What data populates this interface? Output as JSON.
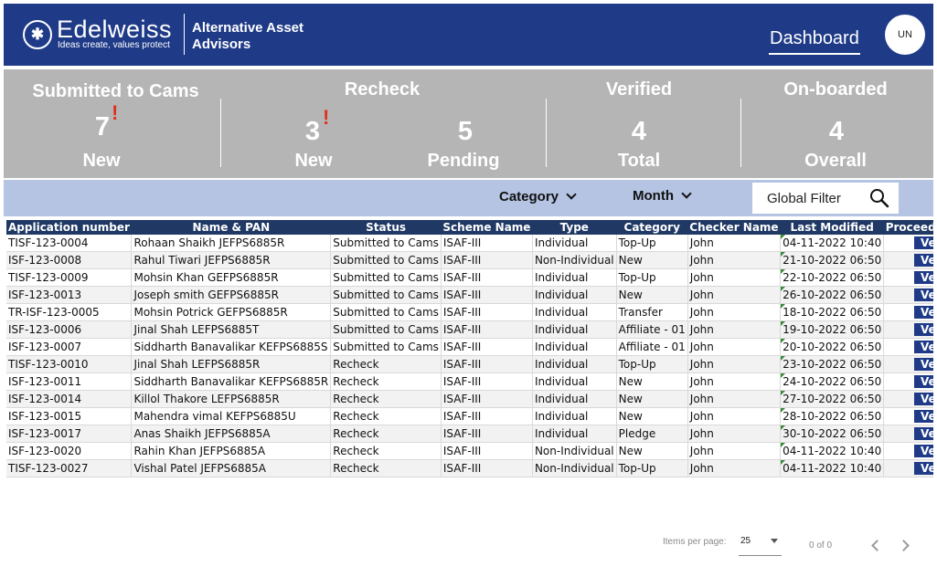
{
  "header": {
    "brand": "Edelweiss",
    "tagline": "Ideas create, values protect",
    "subbrand": "Alternative Asset Advisors",
    "nav_dashboard": "Dashboard",
    "user_initials": "UN",
    "logo_icon": "edelweiss-flower-icon",
    "colors": {
      "header_bg": "#1f3b88",
      "summary_bg": "#b5b5b5",
      "filter_bg": "#b4c4e2",
      "table_header_bg": "#1f3864",
      "alert": "#e0301e"
    }
  },
  "summary": {
    "submitted": {
      "title": "Submitted to Cams",
      "count": "7",
      "label": "New",
      "alert": "!"
    },
    "recheck": {
      "title": "Recheck",
      "new_count": "3",
      "new_label": "New",
      "alert": "!",
      "pending_count": "5",
      "pending_label": "Pending"
    },
    "verified": {
      "title": "Verified",
      "count": "4",
      "label": "Total"
    },
    "onboarded": {
      "title": "On-boarded",
      "count": "4",
      "label": "Overall"
    }
  },
  "filters": {
    "category": "Category",
    "month": "Month",
    "global": "Global Filter",
    "search_icon": "search-icon"
  },
  "table": {
    "columns": [
      "Application number",
      "Name & PAN",
      "Status",
      "Scheme Name",
      "Type",
      "Category",
      "Checker Name",
      "Last Modified",
      "Proceed to verify"
    ],
    "verify_label": "Verify",
    "rows": [
      [
        "TISF-123-0004",
        "Rohaan Shaikh JEFPS6885R",
        "Submitted to Cams",
        "ISAF-III",
        "Individual",
        "Top-Up",
        "John",
        "04-11-2022 10:40"
      ],
      [
        "ISF-123-0008",
        "Rahul Tiwari JEFPS6885R",
        "Submitted to Cams",
        "ISAF-III",
        "Non-Individual",
        "New",
        "John",
        "21-10-2022 06:50"
      ],
      [
        "TISF-123-0009",
        "Mohsin Khan GEFPS6885R",
        "Submitted to Cams",
        "ISAF-III",
        "Individual",
        "Top-Up",
        "John",
        "22-10-2022 06:50"
      ],
      [
        "ISF-123-0013",
        "Joseph smith GEFPS6885R",
        "Submitted to Cams",
        "ISAF-III",
        "Individual",
        "New",
        "John",
        "26-10-2022 06:50"
      ],
      [
        "TR-ISF-123-0005",
        "Mohsin Potrick GEFPS6885R",
        "Submitted to Cams",
        "ISAF-III",
        "Individual",
        "Transfer",
        "John",
        "18-10-2022 06:50"
      ],
      [
        "ISF-123-0006",
        "Jinal Shah LEFPS6885T",
        "Submitted to Cams",
        "ISAF-III",
        "Individual",
        "Affiliate - 01",
        "John",
        "19-10-2022 06:50"
      ],
      [
        "ISF-123-0007",
        "Siddharth Banavalikar KEFPS6885S",
        "Submitted to Cams",
        "ISAF-III",
        "Individual",
        "Affiliate - 01",
        "John",
        "20-10-2022 06:50"
      ],
      [
        "TISF-123-0010",
        "Jinal Shah LEFPS6885R",
        "Recheck",
        "ISAF-III",
        "Individual",
        "Top-Up",
        "John",
        "23-10-2022 06:50"
      ],
      [
        "ISF-123-0011",
        "Siddharth Banavalikar KEFPS6885R",
        "Recheck",
        "ISAF-III",
        "Individual",
        "New",
        "John",
        "24-10-2022 06:50"
      ],
      [
        "ISF-123-0014",
        "Killol Thakore LEFPS6885R",
        "Recheck",
        "ISAF-III",
        "Individual",
        "New",
        "John",
        "27-10-2022 06:50"
      ],
      [
        "ISF-123-0015",
        "Mahendra vimal KEFPS6885U",
        "Recheck",
        "ISAF-III",
        "Individual",
        "New",
        "John",
        "28-10-2022 06:50"
      ],
      [
        "ISF-123-0017",
        "Anas Shaikh JEFPS6885A",
        "Recheck",
        "ISAF-III",
        "Individual",
        "Pledge",
        "John",
        "30-10-2022 06:50"
      ],
      [
        "ISF-123-0020",
        "Rahin Khan JEFPS6885A",
        "Recheck",
        "ISAF-III",
        "Non-Individual",
        "New",
        "John",
        "04-11-2022 10:40"
      ],
      [
        "TISF-123-0027",
        "Vishal Patel JEFPS6885A",
        "Recheck",
        "ISAF-III",
        "Non-Individual",
        "Top-Up",
        "John",
        "04-11-2022 10:40"
      ]
    ]
  },
  "pagination": {
    "items_label": "Items per page:",
    "page_size": "25",
    "range": "0 of 0"
  }
}
